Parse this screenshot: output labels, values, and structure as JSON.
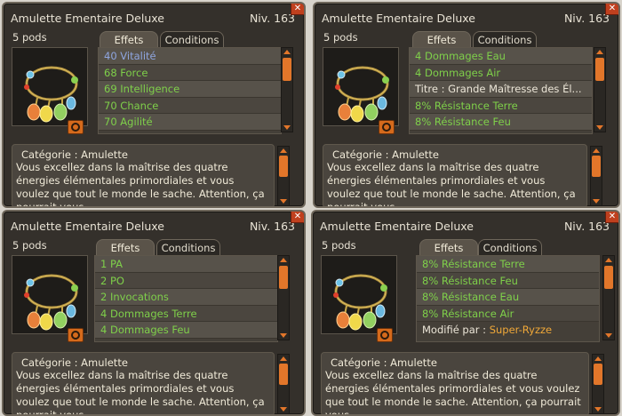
{
  "panels": [
    {
      "title": "Amulette Ementaire Deluxe",
      "level": "Niv. 163",
      "pods": "5 pods",
      "tab_effects": "Effets",
      "tab_conditions": "Conditions",
      "stats": [
        {
          "text": "40 Vitalité",
          "color": "blue"
        },
        {
          "text": "68 Force",
          "color": "green"
        },
        {
          "text": "69 Intelligence",
          "color": "green"
        },
        {
          "text": "70 Chance",
          "color": "green"
        },
        {
          "text": "70 Agilité",
          "color": "green"
        }
      ],
      "modified_label": "",
      "modified_by": "",
      "category": "Catégorie : Amulette",
      "description": "Vous excellez dans la maîtrise des quatre énergies élémentales primordiales et vous voulez que tout le monde le sache. Attention, ça pourrait vous",
      "close": "✕"
    },
    {
      "title": "Amulette Ementaire Deluxe",
      "level": "Niv. 163",
      "pods": "5 pods",
      "tab_effects": "Effets",
      "tab_conditions": "Conditions",
      "stats": [
        {
          "text": "4 Dommages Eau",
          "color": "green"
        },
        {
          "text": "4 Dommages Air",
          "color": "green"
        },
        {
          "text": "Titre : Grande Maîtresse des Él...",
          "color": "white"
        },
        {
          "text": "8% Résistance Terre",
          "color": "green"
        },
        {
          "text": "8% Résistance Feu",
          "color": "green"
        }
      ],
      "modified_label": "",
      "modified_by": "",
      "category": "Catégorie : Amulette",
      "description": "Vous excellez dans la maîtrise des quatre énergies élémentales primordiales et vous voulez que tout le monde le sache. Attention, ça pourrait vous",
      "close": "✕"
    },
    {
      "title": "Amulette Ementaire Deluxe",
      "level": "Niv. 163",
      "pods": "5 pods",
      "tab_effects": "Effets",
      "tab_conditions": "Conditions",
      "stats": [
        {
          "text": "1 PA",
          "color": "green"
        },
        {
          "text": "2 PO",
          "color": "green"
        },
        {
          "text": "2 Invocations",
          "color": "green"
        },
        {
          "text": "4 Dommages Terre",
          "color": "green"
        },
        {
          "text": "4 Dommages Feu",
          "color": "green"
        }
      ],
      "modified_label": "",
      "modified_by": "",
      "category": "Catégorie : Amulette",
      "description": "Vous excellez dans la maîtrise des quatre énergies élémentales primordiales et vous voulez que tout le monde le sache. Attention, ça pourrait vous",
      "close": "✕"
    },
    {
      "title": "Amulette Ementaire Deluxe",
      "level": "Niv. 163",
      "pods": "5 pods",
      "tab_effects": "Effets",
      "tab_conditions": "Conditions",
      "stats": [
        {
          "text": "8% Résistance Terre",
          "color": "green"
        },
        {
          "text": "8% Résistance Feu",
          "color": "green"
        },
        {
          "text": "8% Résistance Eau",
          "color": "green"
        },
        {
          "text": "8% Résistance Air",
          "color": "green"
        }
      ],
      "modified_label": "Modifié par :",
      "modified_by": "Super-Ryzze",
      "category": "Catégorie : Amulette",
      "description": "Vous excellez dans la maîtrise des quatre énergies élémentales primordiales et vous voulez que tout le monde le sache. Attention, ça pourrait vous",
      "close": "✕"
    }
  ],
  "colors": {
    "blue": "#8fa6e0",
    "green": "#7fd04a",
    "white": "#ece6d8",
    "orange": "#f0a838",
    "accent": "#e2762a"
  }
}
